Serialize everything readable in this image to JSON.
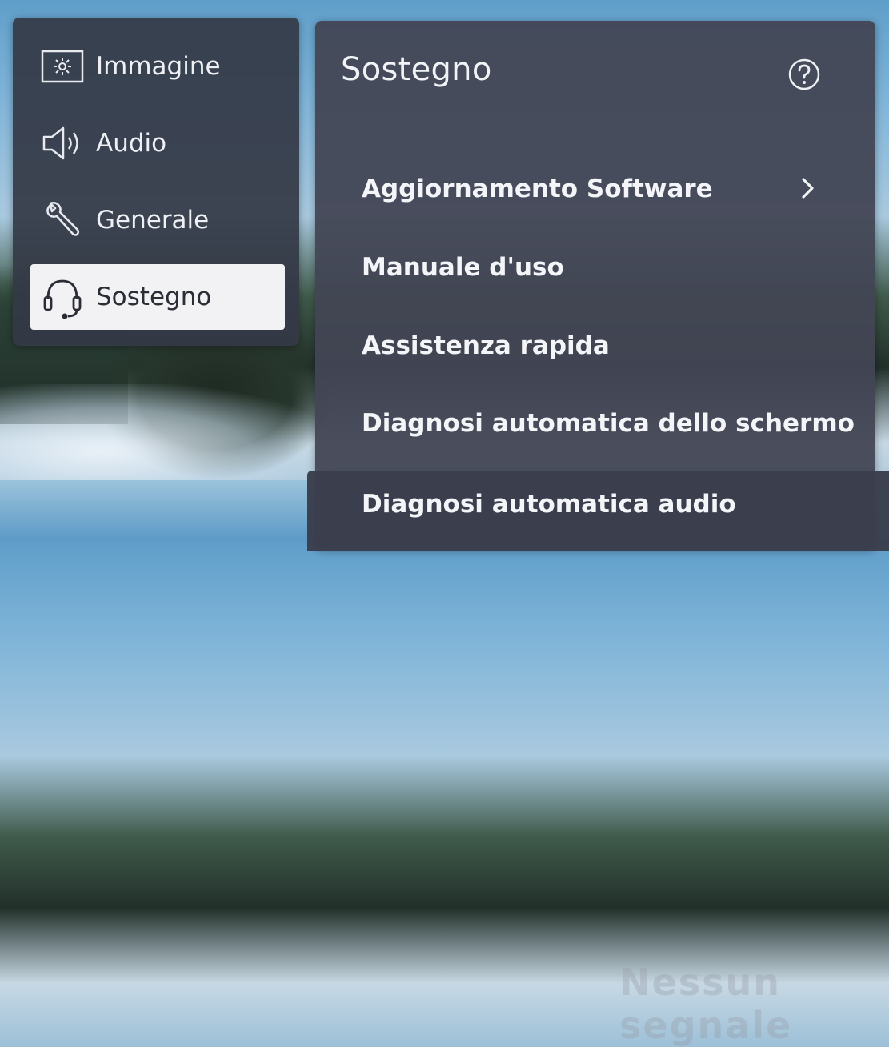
{
  "nav": {
    "items": [
      {
        "label": "Immagine",
        "icon": "picture-settings-icon",
        "selected": false
      },
      {
        "label": "Audio",
        "icon": "speaker-icon",
        "selected": false
      },
      {
        "label": "Generale",
        "icon": "wrench-icon",
        "selected": false
      },
      {
        "label": "Sostegno",
        "icon": "headset-icon",
        "selected": true
      }
    ]
  },
  "panel": {
    "title": "Sostegno",
    "help_icon": "help-icon",
    "items": [
      {
        "label": "Aggiornamento Software",
        "has_chevron": true
      },
      {
        "label": "Manuale d'uso",
        "has_chevron": false
      },
      {
        "label": "Assistenza rapida",
        "has_chevron": false
      },
      {
        "label": "Diagnosi automatica dello schermo",
        "has_chevron": false
      },
      {
        "label": "Diagnosi automatica audio",
        "has_chevron": false
      }
    ]
  },
  "background_overlay_text": "Nessun segnale",
  "colors": {
    "panel_bg": "#343946",
    "selected_bg": "#f2f2f4",
    "text": "#f4f5f8"
  }
}
